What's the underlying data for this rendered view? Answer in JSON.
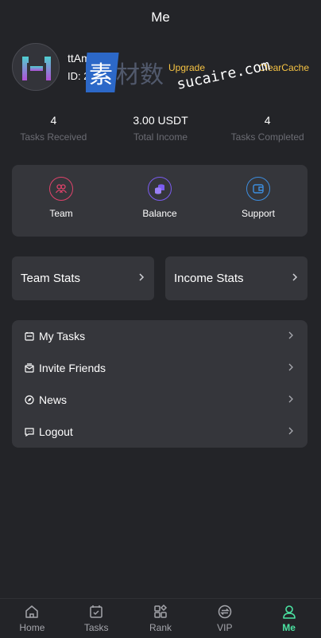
{
  "header": {
    "title": "Me"
  },
  "profile": {
    "name": "ttAm",
    "id_text": "ID: 2",
    "upgrade_label": "Upgrade",
    "clearcache_label": "ClearCache",
    "watermark_cn": "素材数",
    "watermark_en": "sucaire.com"
  },
  "stats": [
    {
      "value": "4",
      "label": "Tasks Received"
    },
    {
      "value": "3.00 USDT",
      "label": "Total Income"
    },
    {
      "value": "4",
      "label": "Tasks Completed"
    }
  ],
  "shortcuts": [
    {
      "label": "Team",
      "icon": "team-icon",
      "color": "#e0436b"
    },
    {
      "label": "Balance",
      "icon": "coins-icon",
      "color": "#7b5cf0"
    },
    {
      "label": "Support",
      "icon": "wallet-icon",
      "color": "#3d8ee0"
    }
  ],
  "stat_buttons": {
    "team": "Team Stats",
    "income": "Income Stats"
  },
  "menu": [
    {
      "label": "My Tasks",
      "icon": "tasks-icon"
    },
    {
      "label": "Invite Friends",
      "icon": "invite-icon"
    },
    {
      "label": "News",
      "icon": "news-icon"
    },
    {
      "label": "Logout",
      "icon": "chat-icon"
    }
  ],
  "tabs": [
    {
      "label": "Home",
      "icon": "home-icon",
      "active": false
    },
    {
      "label": "Tasks",
      "icon": "tasks-icon",
      "active": false
    },
    {
      "label": "Rank",
      "icon": "rank-icon",
      "active": false
    },
    {
      "label": "VIP",
      "icon": "vip-icon",
      "active": false
    },
    {
      "label": "Me",
      "icon": "user-icon",
      "active": true
    }
  ],
  "colors": {
    "accent": "#4be3a2",
    "warning": "#f6c343",
    "card": "#35363b",
    "background": "#232428"
  }
}
